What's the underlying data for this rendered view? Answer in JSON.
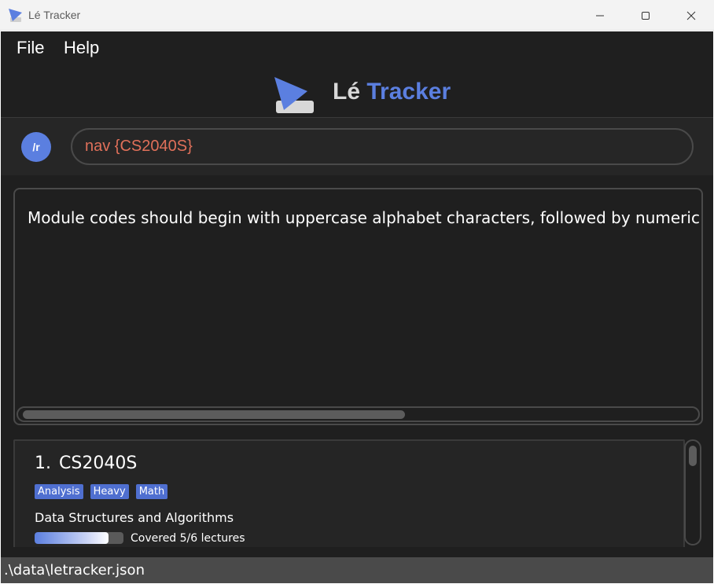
{
  "window": {
    "title": "Lé Tracker",
    "icons": {
      "app": "le-tracker-logo",
      "minimize": "minimize-icon",
      "maximize": "maximize-icon",
      "close": "close-icon"
    }
  },
  "menu": {
    "file": "File",
    "help": "Help"
  },
  "header": {
    "logo_le": "Lé",
    "logo_tracker": "Tracker"
  },
  "command": {
    "badge": "/r",
    "value": "nav {CS2040S}"
  },
  "result": {
    "text": "Module codes should begin with uppercase alphabet characters, followed by numeric cha"
  },
  "modules": [
    {
      "index": "1.",
      "code": "CS2040S",
      "tags": [
        "Analysis",
        "Heavy",
        "Math"
      ],
      "name": "Data Structures and Algorithms",
      "progress_fraction": 0.8333,
      "progress_label": "Covered 5/6 lectures"
    }
  ],
  "status": {
    "path": ".\\data\\letracker.json"
  },
  "colors": {
    "accent": "#5b7fe0",
    "command_text": "#e0705a",
    "background": "#1f1f1f",
    "tag": "#4f6fd0"
  }
}
